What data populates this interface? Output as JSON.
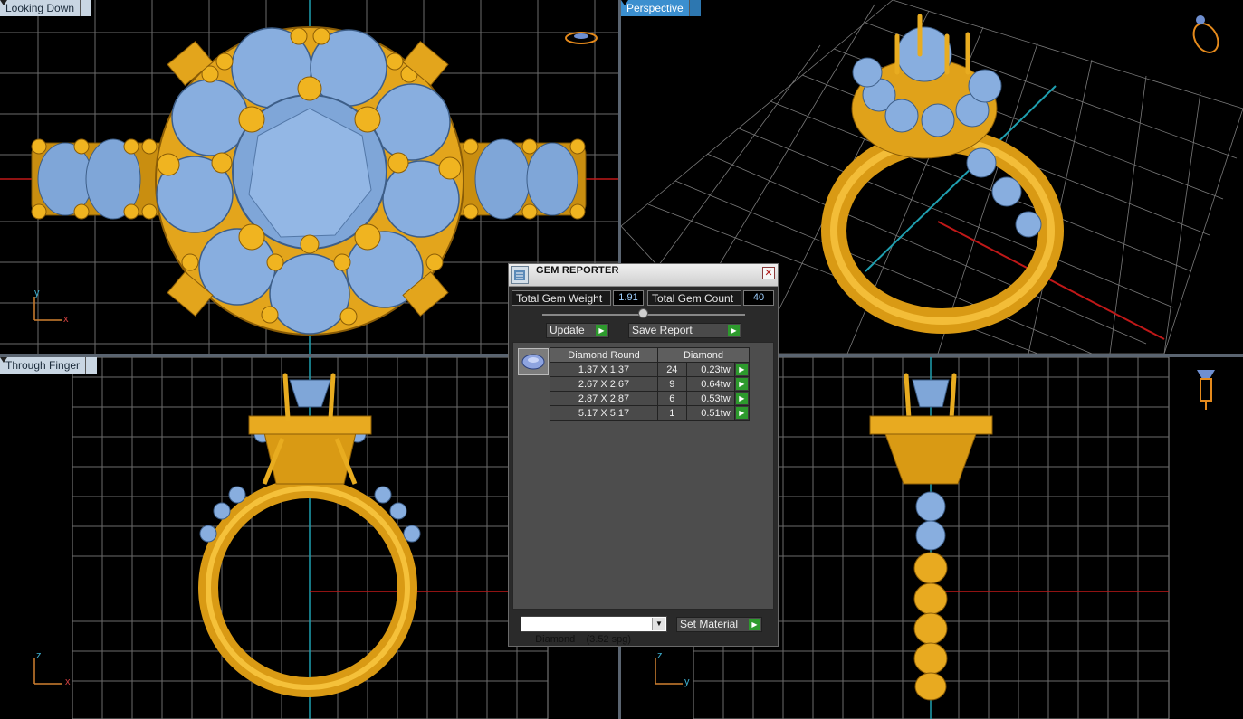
{
  "viewports": {
    "top_left": {
      "label": "Looking Down",
      "axis_a": "y",
      "axis_b": "x"
    },
    "top_right": {
      "label": "Perspective"
    },
    "bottom_left": {
      "label": "Through Finger",
      "axis_a": "z",
      "axis_b": "x"
    },
    "bottom_right": {
      "axis_a": "z",
      "axis_b": "y"
    }
  },
  "dialog": {
    "title": "GEM REPORTER",
    "close_glyph": "✕",
    "total_weight_label": "Total Gem Weight",
    "total_weight_value": "1.91",
    "total_count_label": "Total Gem Count",
    "total_count_value": "40",
    "update_label": "Update",
    "save_report_label": "Save Report",
    "table": {
      "headers": [
        "Diamond Round",
        "Diamond"
      ],
      "rows": [
        {
          "size": "1.37 X 1.37",
          "count": "24",
          "weight": "0.23tw"
        },
        {
          "size": "2.67 X 2.67",
          "count": "9",
          "weight": "0.64tw"
        },
        {
          "size": "2.87 X 2.87",
          "count": "6",
          "weight": "0.53tw"
        },
        {
          "size": "5.17 X 5.17",
          "count": "1",
          "weight": "0.51tw"
        }
      ]
    },
    "material_select": "Diamond    (3.52 spg)",
    "set_material_label": "Set Material"
  },
  "colors": {
    "gold": "#e0a21a",
    "gold_dark": "#9a6a08",
    "gem": "#7fa6d8",
    "gem_light": "#b8d3f3",
    "grid": "#707070",
    "axis_red": "#c01818",
    "axis_cyan": "#1f9fb0",
    "accent_blue": "#3b8fcf"
  },
  "icons": {
    "go_arrow": "play-icon",
    "dropdown": "chevron-down-icon",
    "gem": "gem-icon"
  }
}
